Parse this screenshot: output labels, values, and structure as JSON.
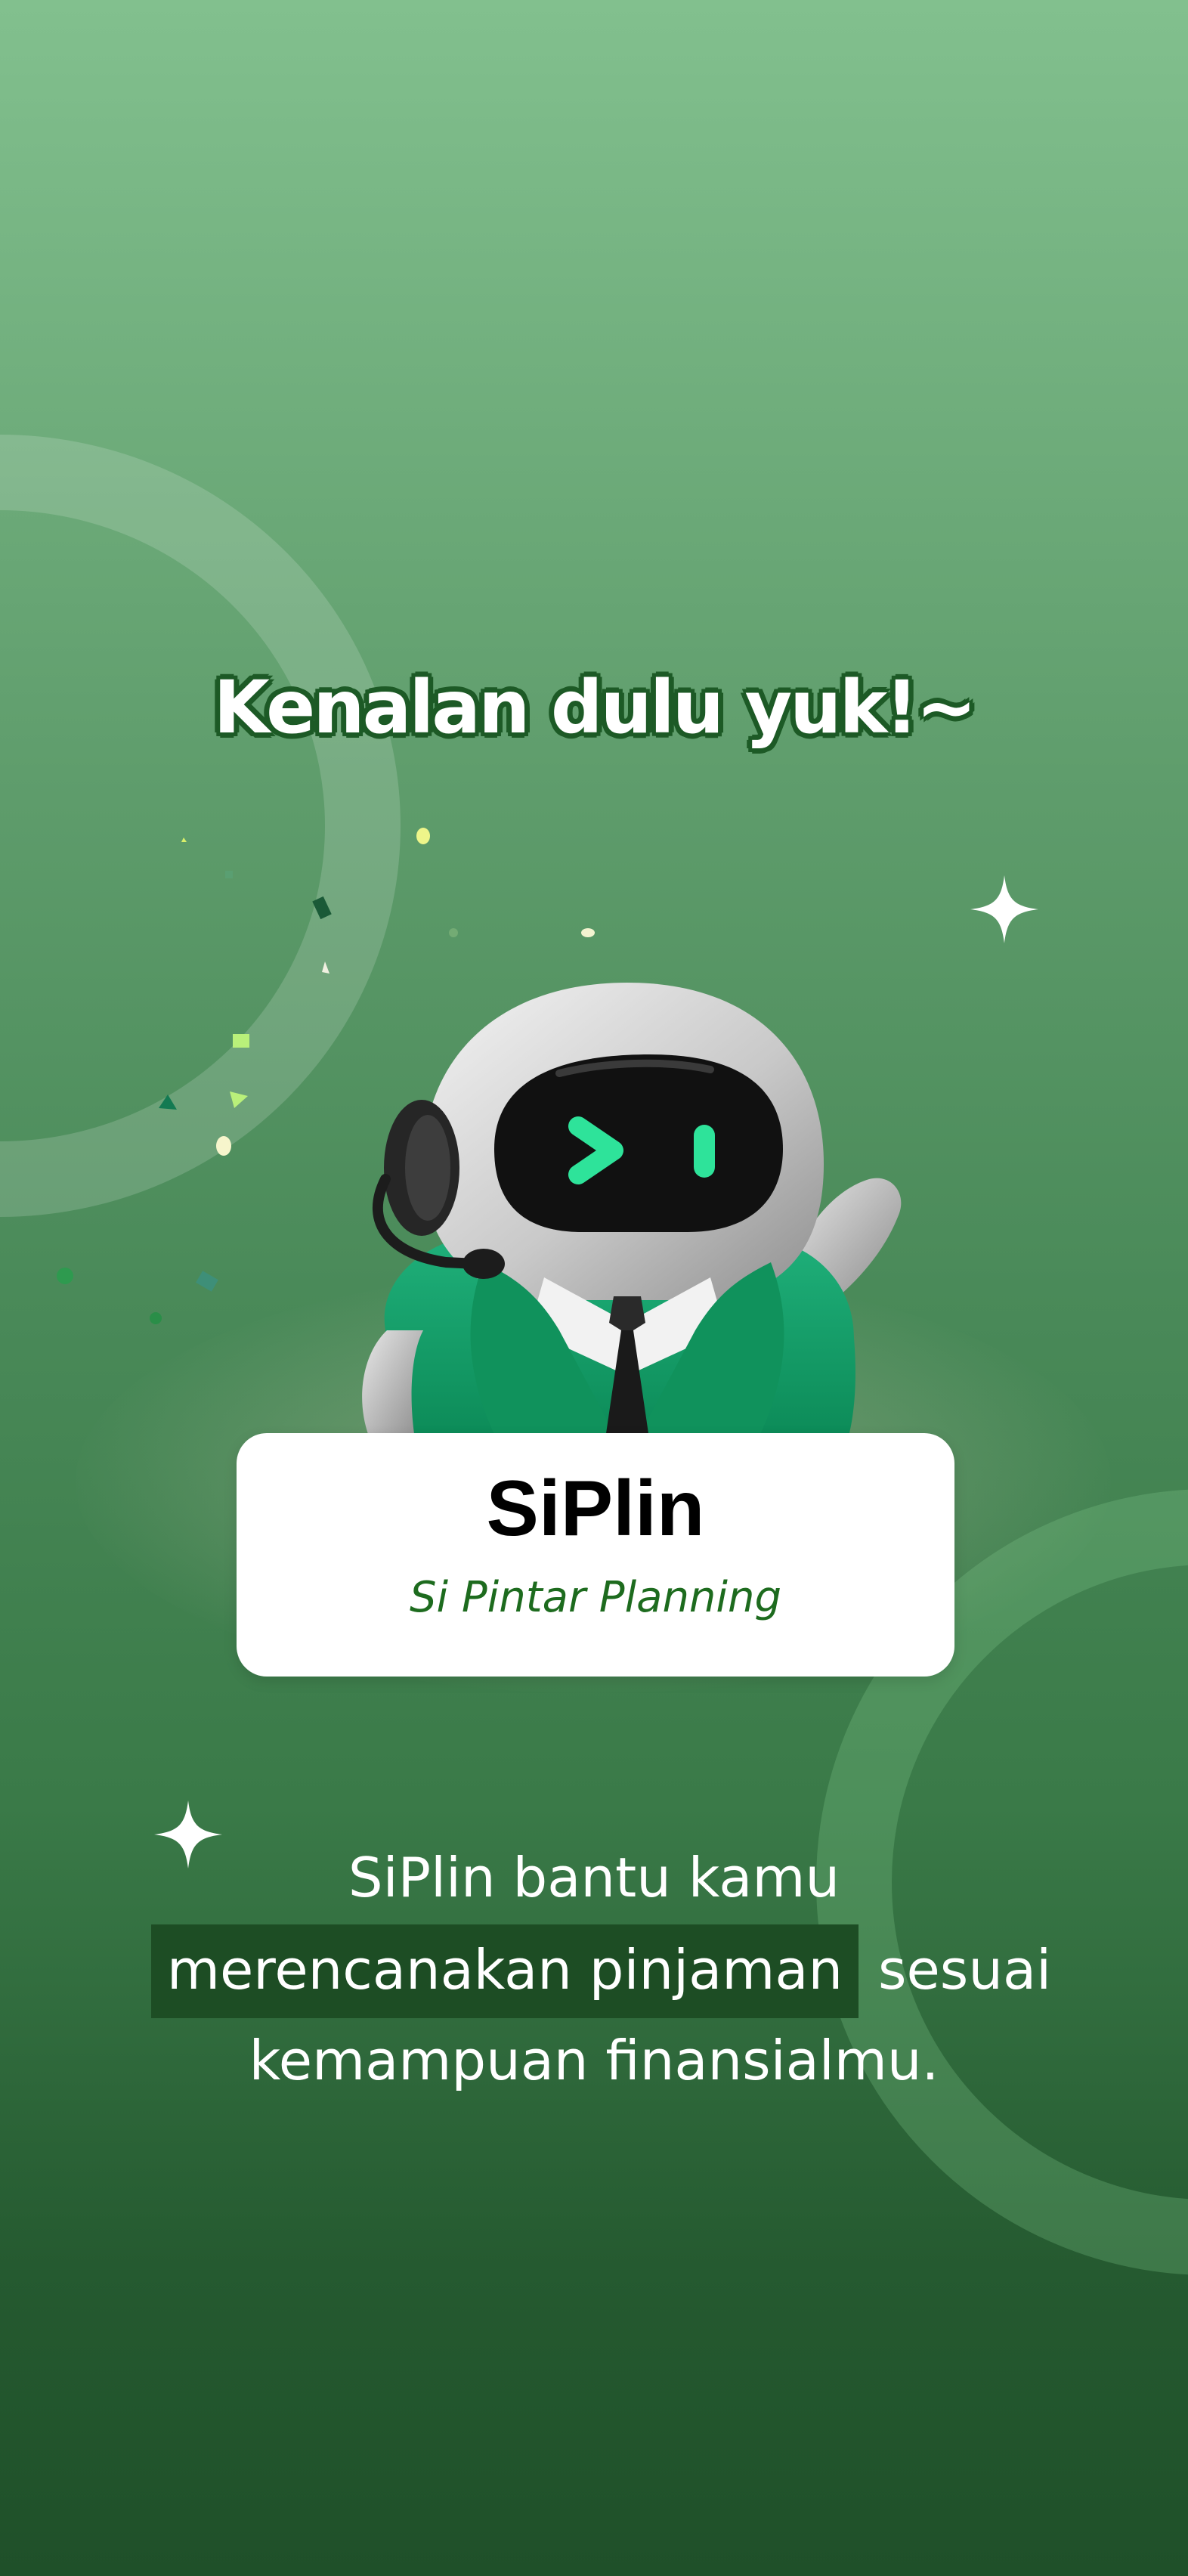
{
  "intro": {
    "headline": "Kenalan dulu yuk!~"
  },
  "mascot": {
    "icon": "robot-mascot-icon"
  },
  "name_card": {
    "title": "SiPlin",
    "subtitle": "Si Pintar Planning"
  },
  "description": {
    "line1": "SiPlin bantu kamu",
    "highlight": "merencanakan pinjaman",
    "line2_rest": "sesuai",
    "line3": "kemampuan finansialmu."
  },
  "colors": {
    "accent_green": "#1d6b1e",
    "highlight_bg": "#1d4d24",
    "mascot_green": "#17a06b"
  }
}
